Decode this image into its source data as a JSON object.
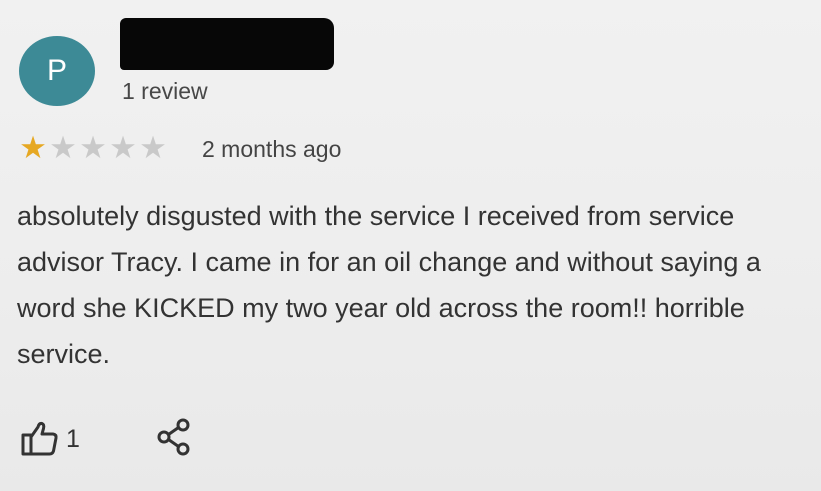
{
  "reviewer": {
    "avatar_letter": "P",
    "avatar_color": "#3d8a96",
    "review_count": "1 review"
  },
  "rating": {
    "stars_filled": 1,
    "stars_total": 5,
    "time_ago": "2 months ago",
    "star_color": "#e6a823"
  },
  "review": {
    "text": "absolutely disgusted with the service I received from service advisor Tracy. I came in for an oil change and without saying a word she KICKED my two year old across the room!! horrible service."
  },
  "actions": {
    "like_icon": "thumbs-up-icon",
    "like_count": "1",
    "share_icon": "share-icon"
  }
}
